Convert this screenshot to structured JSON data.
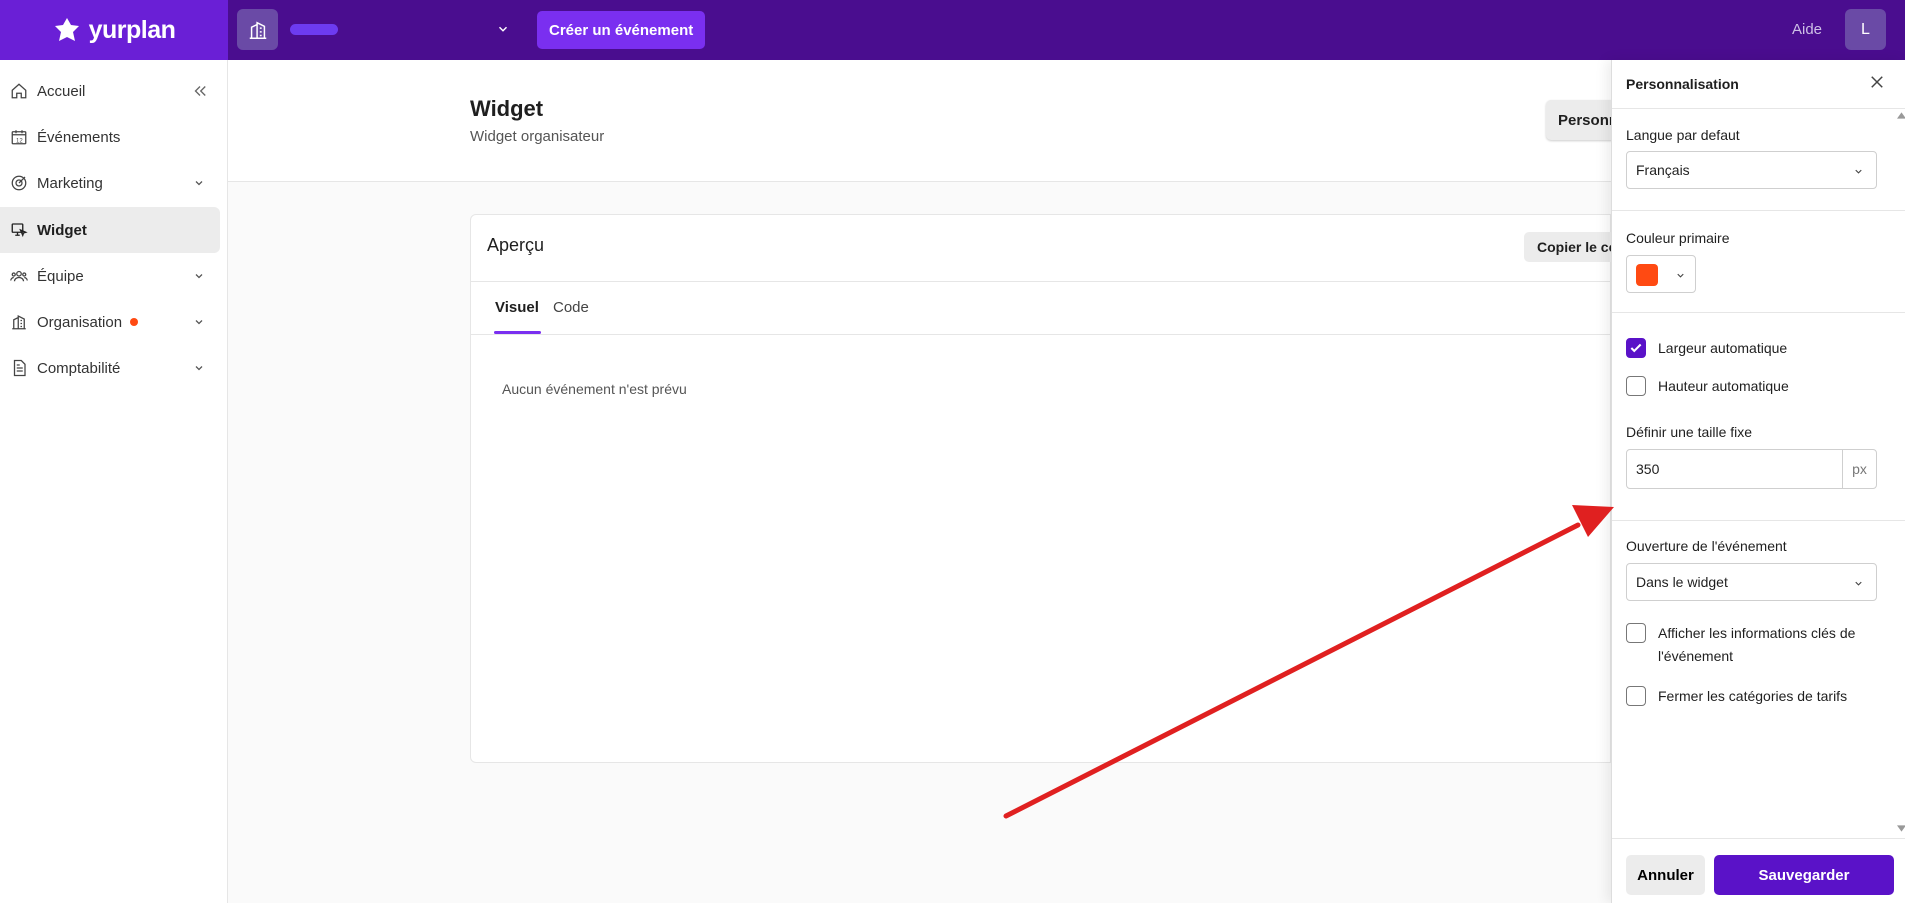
{
  "app": {
    "brand": "yurplan"
  },
  "topbar": {
    "create_label": "Créer un événement",
    "help_label": "Aide",
    "avatar_initial": "L"
  },
  "sidebar": {
    "items": [
      {
        "label": "Accueil",
        "icon": "home-icon"
      },
      {
        "label": "Événements",
        "icon": "calendar-icon"
      },
      {
        "label": "Marketing",
        "icon": "target-icon"
      },
      {
        "label": "Widget",
        "icon": "widget-icon",
        "active": true
      },
      {
        "label": "Équipe",
        "icon": "team-icon"
      },
      {
        "label": "Organisation",
        "icon": "building-icon"
      },
      {
        "label": "Comptabilité",
        "icon": "document-icon"
      }
    ]
  },
  "header": {
    "title": "Widget",
    "subtitle": "Widget organisateur",
    "perso_button": "Personnaliser"
  },
  "preview": {
    "title": "Aperçu",
    "copy_button": "Copier le code",
    "tabs": [
      "Visuel",
      "Code"
    ],
    "empty_message": "Aucun événement n'est prévu"
  },
  "panel": {
    "title": "Personnalisation",
    "language": {
      "label": "Langue par defaut",
      "value": "Français"
    },
    "primary_color": {
      "label": "Couleur primaire",
      "value": "#ff4a12"
    },
    "auto_width": {
      "label": "Largeur automatique",
      "checked": true
    },
    "auto_height": {
      "label": "Hauteur automatique",
      "checked": false
    },
    "fixed_size": {
      "label": "Définir une taille fixe",
      "value": "350",
      "unit": "px"
    },
    "opening": {
      "label": "Ouverture de l'événement",
      "value": "Dans le widget"
    },
    "show_key_info": {
      "label": "Afficher les informations clés de l'événement",
      "checked": false
    },
    "close_categories": {
      "label": "Fermer les catégories de tarifs",
      "checked": false
    },
    "cancel_button": "Annuler",
    "save_button": "Sauvegarder"
  },
  "colors": {
    "brand": "#6a1fd6",
    "topbar": "#4a0d8f",
    "accent": "#5a12c8",
    "notification": "#ff4a12",
    "annotation": "#e02020"
  }
}
